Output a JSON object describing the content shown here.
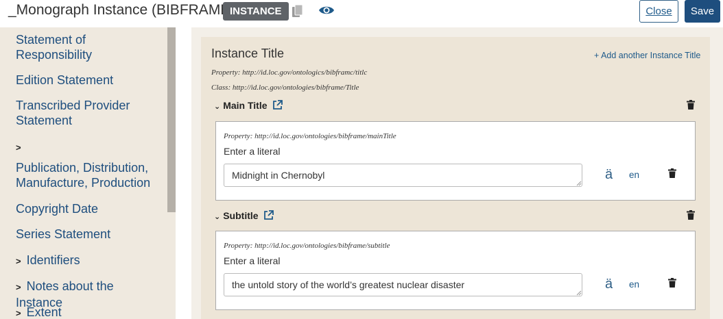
{
  "header": {
    "title": "_Monograph Instance (BIBFRAME)",
    "badge": "INSTANCE",
    "close_label": "Close",
    "save_label": "Save"
  },
  "nav": {
    "items": [
      {
        "label": "Statement of Responsibility",
        "caret": false
      },
      {
        "label": "Edition Statement",
        "caret": false
      },
      {
        "label": "Transcribed Provider Statement",
        "caret": false
      },
      {
        "label": "",
        "caret": true
      },
      {
        "label": "Publication, Distribution, Manufacture, Production",
        "caret": false
      },
      {
        "label": "Copyright Date",
        "caret": false
      },
      {
        "label": "Series Statement",
        "caret": false
      },
      {
        "label": "Identifiers",
        "caret": true
      },
      {
        "label": "Notes about the Instance",
        "caret": true
      },
      {
        "label": "Extent",
        "caret": true
      }
    ]
  },
  "panel": {
    "title": "Instance Title",
    "add_link": "+ Add another Instance Title",
    "property": "Property: http://id.loc.gov/ontologics/bibframc/titlc",
    "class": "Class: http://id.loc.gov/ontologies/bibframe/Title",
    "sections": [
      {
        "heading": "Main Title",
        "property": "Property: http://id.loc.gov/ontologies/bibframe/mainTitle",
        "label": "Enter a literal",
        "value": "Midnight in Chernobyl",
        "diacritic": "ä",
        "lang": "en"
      },
      {
        "heading": "Subtitle",
        "property": "Property: http://id.loc.gov/ontologies/bibframe/subtitle",
        "label": "Enter a literal",
        "value": "the untold story of the world’s greatest nuclear disaster",
        "diacritic": "ä",
        "lang": "en"
      }
    ]
  },
  "colors": {
    "primary": "#1e4e7e",
    "link": "#1e5a8a",
    "nav_bg": "#efe9df",
    "panel_bg": "#ede5d7"
  },
  "icons": [
    "copy-icon",
    "eye-icon",
    "chevron-right-icon",
    "chevron-down-icon",
    "external-link-icon",
    "trash-icon",
    "resize-grip-icon"
  ]
}
